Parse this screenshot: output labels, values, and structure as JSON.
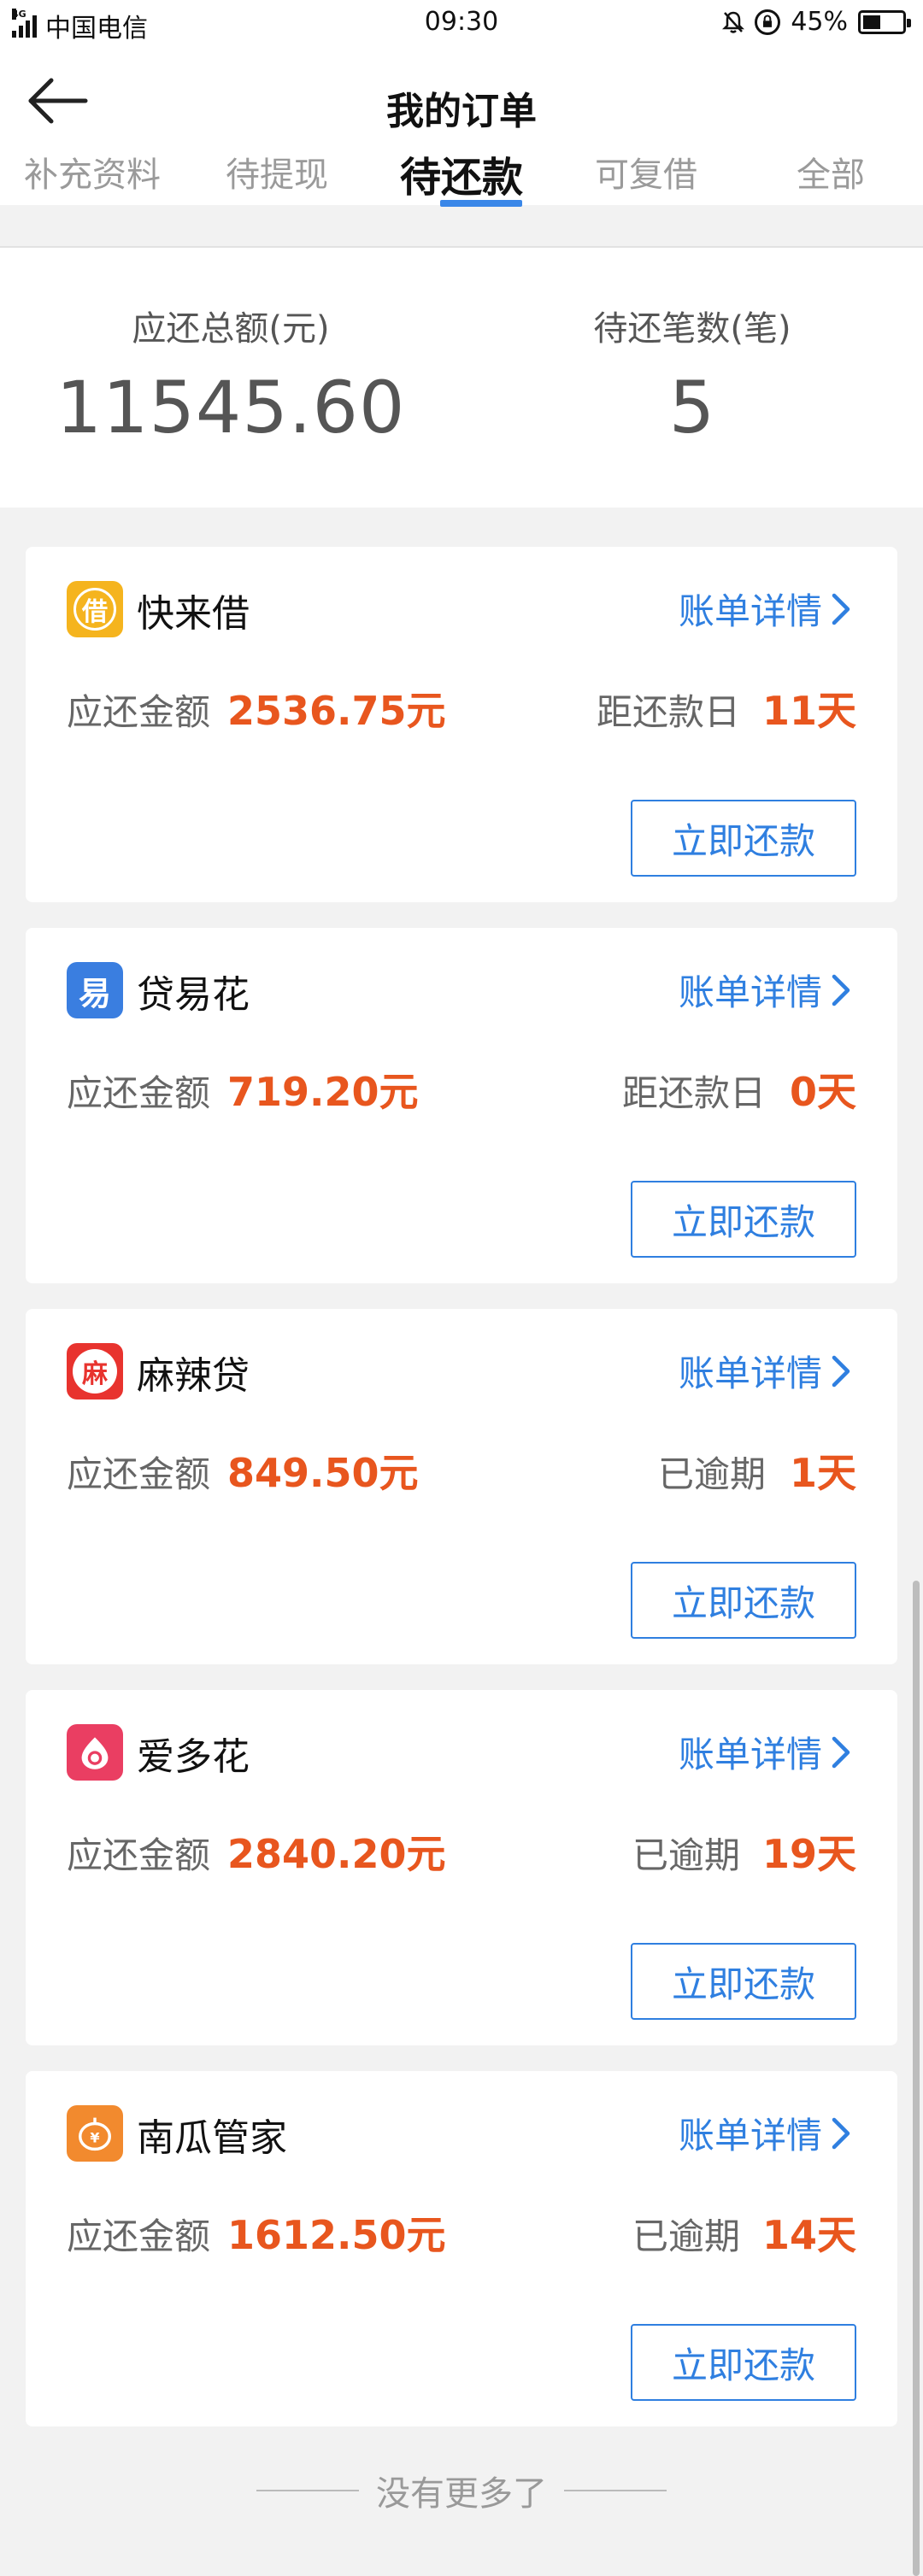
{
  "status_bar": {
    "network": "4G",
    "carrier": "中国电信",
    "time": "09:30",
    "battery": "45%",
    "icons": [
      "signal-icon",
      "bell-muted-icon",
      "rotation-lock-icon",
      "battery-icon"
    ]
  },
  "header": {
    "title": "我的订单",
    "back_icon": "arrow-left-icon",
    "tabs": [
      {
        "label": "补充资料",
        "active": false
      },
      {
        "label": "待提现",
        "active": false
      },
      {
        "label": "待还款",
        "active": true
      },
      {
        "label": "可复借",
        "active": false
      },
      {
        "label": "全部",
        "active": false
      }
    ]
  },
  "summary": {
    "total_label": "应还总额(元)",
    "total_value": "11545.60",
    "count_label": "待还笔数(笔)",
    "count_value": "5"
  },
  "orders": [
    {
      "name": "快来借",
      "logo_char": "借",
      "logo_color": "#f5b41e",
      "detail_label": "账单详情",
      "amount_label": "应还金额",
      "amount": "2536.75元",
      "due_label": "距还款日",
      "due_value": "11天",
      "button": "立即还款"
    },
    {
      "name": "贷易花",
      "logo_char": "易",
      "logo_color": "#3a7ee0",
      "detail_label": "账单详情",
      "amount_label": "应还金额",
      "amount": "719.20元",
      "due_label": "距还款日",
      "due_value": "0天",
      "button": "立即还款"
    },
    {
      "name": "麻辣贷",
      "logo_char": "麻",
      "logo_color": "#e8332e",
      "detail_label": "账单详情",
      "amount_label": "应还金额",
      "amount": "849.50元",
      "due_label": "已逾期",
      "due_value": "1天",
      "button": "立即还款"
    },
    {
      "name": "爱多花",
      "logo_char": "",
      "logo_color": "#ea3e62",
      "detail_label": "账单详情",
      "amount_label": "应还金额",
      "amount": "2840.20元",
      "due_label": "已逾期",
      "due_value": "19天",
      "button": "立即还款"
    },
    {
      "name": "南瓜管家",
      "logo_char": "",
      "logo_color": "#f28a2e",
      "detail_label": "账单详情",
      "amount_label": "应还金额",
      "amount": "1612.50元",
      "due_label": "已逾期",
      "due_value": "14天",
      "button": "立即还款"
    }
  ],
  "footer": {
    "no_more": "没有更多了"
  },
  "colors": {
    "accent": "#2f7fe0",
    "amount": "#e8561e",
    "tab_indicator": "#3a87e8"
  }
}
